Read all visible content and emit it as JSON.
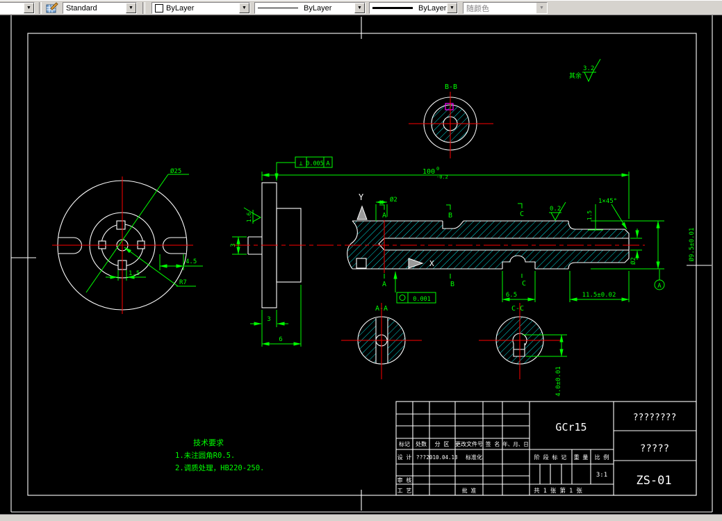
{
  "toolbar": {
    "style": "Standard",
    "color": "ByLayer",
    "linetype": "ByLayer",
    "lineweight": "ByLayer",
    "plot_style": "随颜色",
    "dropdown_glyph": "▼"
  },
  "drawing": {
    "surface_note": {
      "prefix": "其余",
      "value": "3.2"
    },
    "front_view": {
      "dia": "Ø25",
      "offset": "4.5",
      "keyway": "1.5",
      "radius": "R7"
    },
    "main_view": {
      "fcf_perp": {
        "sym": "⊥",
        "tol": "0.005",
        "datum": "A"
      },
      "len": {
        "value": "100",
        "sup": "0",
        "sub": "-0.2"
      },
      "rough_left": "1.6",
      "stub_dia": "3",
      "bore_dia_top": "Ø2",
      "rough_top": "0.2",
      "chamfer": "1×45°",
      "step": "1.5",
      "shaft_dia": "Ø9.5±0.01",
      "bore_dia_end": "Ø2",
      "end_len": "11.5±0.02",
      "slot_w": "6.5",
      "fcf_round": {
        "tol": "0.001"
      },
      "datum_label": "A",
      "flange_t": "3",
      "flange_hub": "6",
      "slot_d": "4.0±0.01",
      "axis_y": "Y",
      "axis_x": "X"
    },
    "sections": {
      "aa": "A-A",
      "bb": "B-B",
      "cc": "C-C",
      "a": "A",
      "b": "B",
      "c": "C"
    },
    "tech_req": {
      "title": "技术要求",
      "line1": "1.未注圆角R0.5.",
      "line2": "2.调质处理，HB220-250."
    }
  },
  "title_block": {
    "h_mark": "标记",
    "h_count": "处数",
    "h_zone": "分 区",
    "h_doc": "更改文件号",
    "h_sign": "签 名",
    "h_date": "年、月、日",
    "design": "设 计",
    "designer": "???",
    "date": "2010.04.13",
    "standardize": "标准化",
    "review": "审 核",
    "process": "工 艺",
    "approve": "批 准",
    "material": "GCr15",
    "stage": "阶 段 标 记",
    "weight": "重 量",
    "scale_h": "比 例",
    "scale": "3:1",
    "sheets": "共 1 张 第 1 张",
    "company": "????????",
    "part": "?????",
    "no": "ZS-01"
  }
}
